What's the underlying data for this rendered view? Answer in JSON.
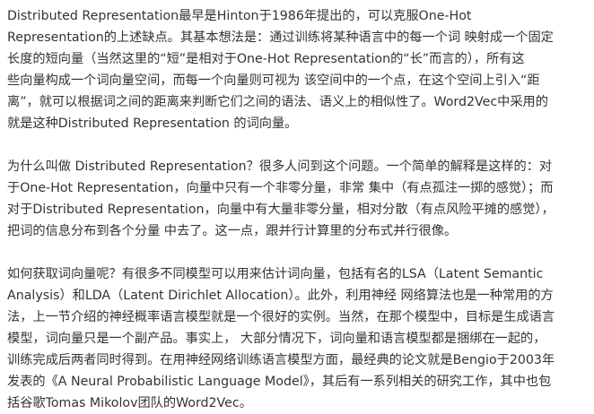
{
  "paragraphs": [
    {
      "lines": [
        "Distributed Representation最早是Hinton于1986年提出的，可以克服One-Hot",
        "Representation的上述缺点。其基本想法是：通过训练将某种语言中的每一个词 映射成一个固定",
        "长度的短向量（当然这里的“短”是相对于One-Hot Representation的“长”而言的），所有这",
        "些向量构成一个词向量空间，而每一个向量则可视为 该空间中的一个点，在这个空间上引入“距",
        "离”，就可以根据词之间的距离来判断它们之间的语法、语义上的相似性了。Word2Vec中采用的",
        "就是这种Distributed Representation 的词向量。"
      ]
    },
    {
      "lines": [
        "为什么叫做 Distributed Representation？很多人问到这个问题。一个简单的解释是这样的：对",
        "于One-Hot Representation，向量中只有一个非零分量，非常 集中（有点孤注一掷的感觉）；而",
        "对于Distributed Representation，向量中有大量非零分量，相对分散（有点风险平摊的感觉），",
        "把词的信息分布到各个分量 中去了。这一点，跟并行计算里的分布式并行很像。"
      ]
    },
    {
      "lines": [
        "如何获取词向量呢？有很多不同模型可以用来估计词向量，包括有名的LSA（Latent Semantic",
        "Analysis）和LDA（Latent Dirichlet Allocation）。此外，利用神经 网络算法也是一种常用的方",
        "法，上一节介绍的神经概率语言模型就是一个很好的实例。当然，在那个模型中，目标是生成语言",
        "模型，词向量只是一个副产品。事实上， 大部分情况下，词向量和语言模型都是捆绑在一起的，",
        "训练完成后两者同时得到。在用神经网络训练语言模型方面，最经典的论文就是Bengio于2003年",
        "发表的《A Neural Probabilistic Language Model》，其后有一系列相关的研究工作，其中也包",
        "括谷歌Tomas Mikolov团队的Word2Vec。"
      ]
    }
  ]
}
